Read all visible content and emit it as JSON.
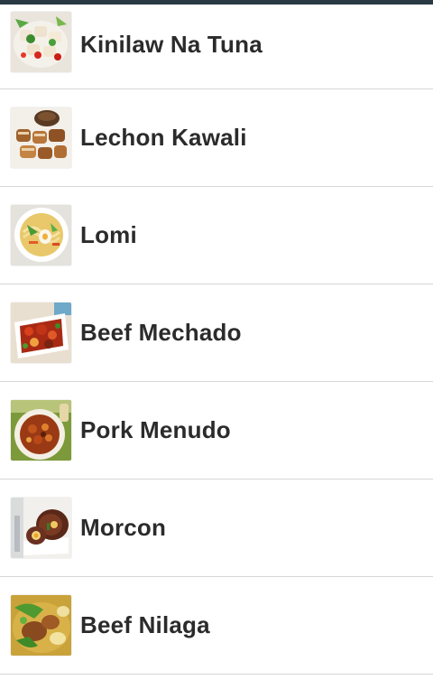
{
  "recipes": [
    {
      "name": "Kinilaw Na Tuna",
      "thumb": "kinilaw-thumbnail-icon"
    },
    {
      "name": "Lechon Kawali",
      "thumb": "lechon-kawali-thumbnail-icon"
    },
    {
      "name": "Lomi",
      "thumb": "lomi-thumbnail-icon"
    },
    {
      "name": "Beef Mechado",
      "thumb": "beef-mechado-thumbnail-icon"
    },
    {
      "name": "Pork Menudo",
      "thumb": "pork-menudo-thumbnail-icon"
    },
    {
      "name": "Morcon",
      "thumb": "morcon-thumbnail-icon"
    },
    {
      "name": "Beef Nilaga",
      "thumb": "beef-nilaga-thumbnail-icon"
    }
  ],
  "colors": {
    "status_bar": "#2a3a44",
    "divider": "#d6d6d6",
    "text": "#2b2b2b"
  }
}
